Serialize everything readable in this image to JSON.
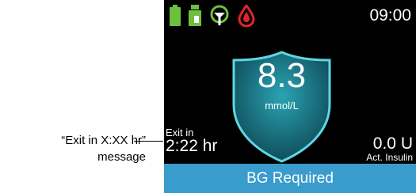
{
  "callout": {
    "line1": "“Exit in X:XX hr”",
    "line2": "message"
  },
  "status_bar": {
    "time": "09:00",
    "icons": [
      "battery-icon",
      "insulin-cartridge-icon",
      "sensor-signal-icon",
      "blood-drop-icon"
    ]
  },
  "reading": {
    "value": "8.3",
    "unit": "mmol/L"
  },
  "exit": {
    "label": "Exit in",
    "time": "2:22 hr"
  },
  "active_insulin": {
    "value": "0.0 U",
    "label": "Act. Insulin"
  },
  "banner": {
    "text": "BG Required"
  },
  "colors": {
    "accent_blue": "#3a9ccc",
    "battery_green": "#6fbf3f",
    "drop_red": "#e0262b",
    "shield_teal": "#5fd6e4"
  }
}
